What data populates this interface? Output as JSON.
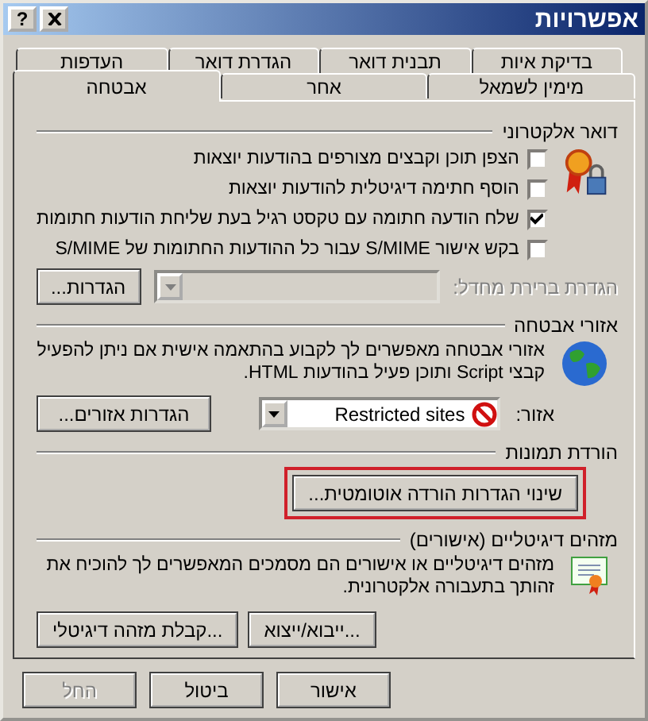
{
  "window": {
    "title": "אפשרויות",
    "help_button": "?"
  },
  "tab_rows": [
    {
      "tabs": [
        {
          "label": "בדיקת איות",
          "selected": false
        },
        {
          "label": "תבנית דואר",
          "selected": false
        },
        {
          "label": "הגדרת דואר",
          "selected": false
        },
        {
          "label": "העדפות",
          "selected": false
        }
      ]
    },
    {
      "tabs": [
        {
          "label": "מימין לשמאל",
          "selected": false
        },
        {
          "label": "אחר",
          "selected": false
        },
        {
          "label": "אבטחה",
          "selected": true
        }
      ]
    }
  ],
  "email": {
    "title": "דואר אלקטרוני",
    "options": [
      {
        "label": "הצפן תוכן וקבצים מצורפים בהודעות יוצאות",
        "checked": false
      },
      {
        "label": "הוסף חתימה דיגיטלית להודעות יוצאות",
        "checked": false
      },
      {
        "label": "שלח הודעה חתומה עם טקסט רגיל בעת שליחת הודעות חתומות",
        "checked": true
      },
      {
        "label": "בקש אישור S/MIME עבור כל ההודעות החתומות של S/MIME",
        "checked": false
      }
    ],
    "default_setting": {
      "label": "הגדרת ברירת מחדל:",
      "disabled": true
    },
    "settings_button": "הגדרות..."
  },
  "security_zones": {
    "title": "אזורי אבטחה",
    "description": "אזורי אבטחה מאפשרים לך לקבוע בהתאמה אישית אם ניתן להפעיל קבצי Script ותוכן פעיל בהודעות HTML.",
    "zone_label": "אזור:",
    "zone_value": "Restricted sites",
    "zone_settings_button": "הגדרות אזורים..."
  },
  "picture_download": {
    "title": "הורדת תמונות",
    "button": "שינוי הגדרות הורדה אוטומטית...",
    "highlighted": true
  },
  "digital_ids": {
    "title": "מזהים דיגיטליים (אישורים)",
    "description": "מזהים דיגיטליים או אישורים הם מסמכים המאפשרים לך להוכיח את זהותך בתעבורה אלקטרונית.",
    "buttons": [
      "ייבוא/ייצוא...",
      "קבלת מזהה דיגיטלי..."
    ]
  },
  "footer_buttons": [
    {
      "label": "אישור",
      "disabled": false
    },
    {
      "label": "ביטול",
      "disabled": false
    },
    {
      "label": "החל",
      "disabled": true
    }
  ]
}
